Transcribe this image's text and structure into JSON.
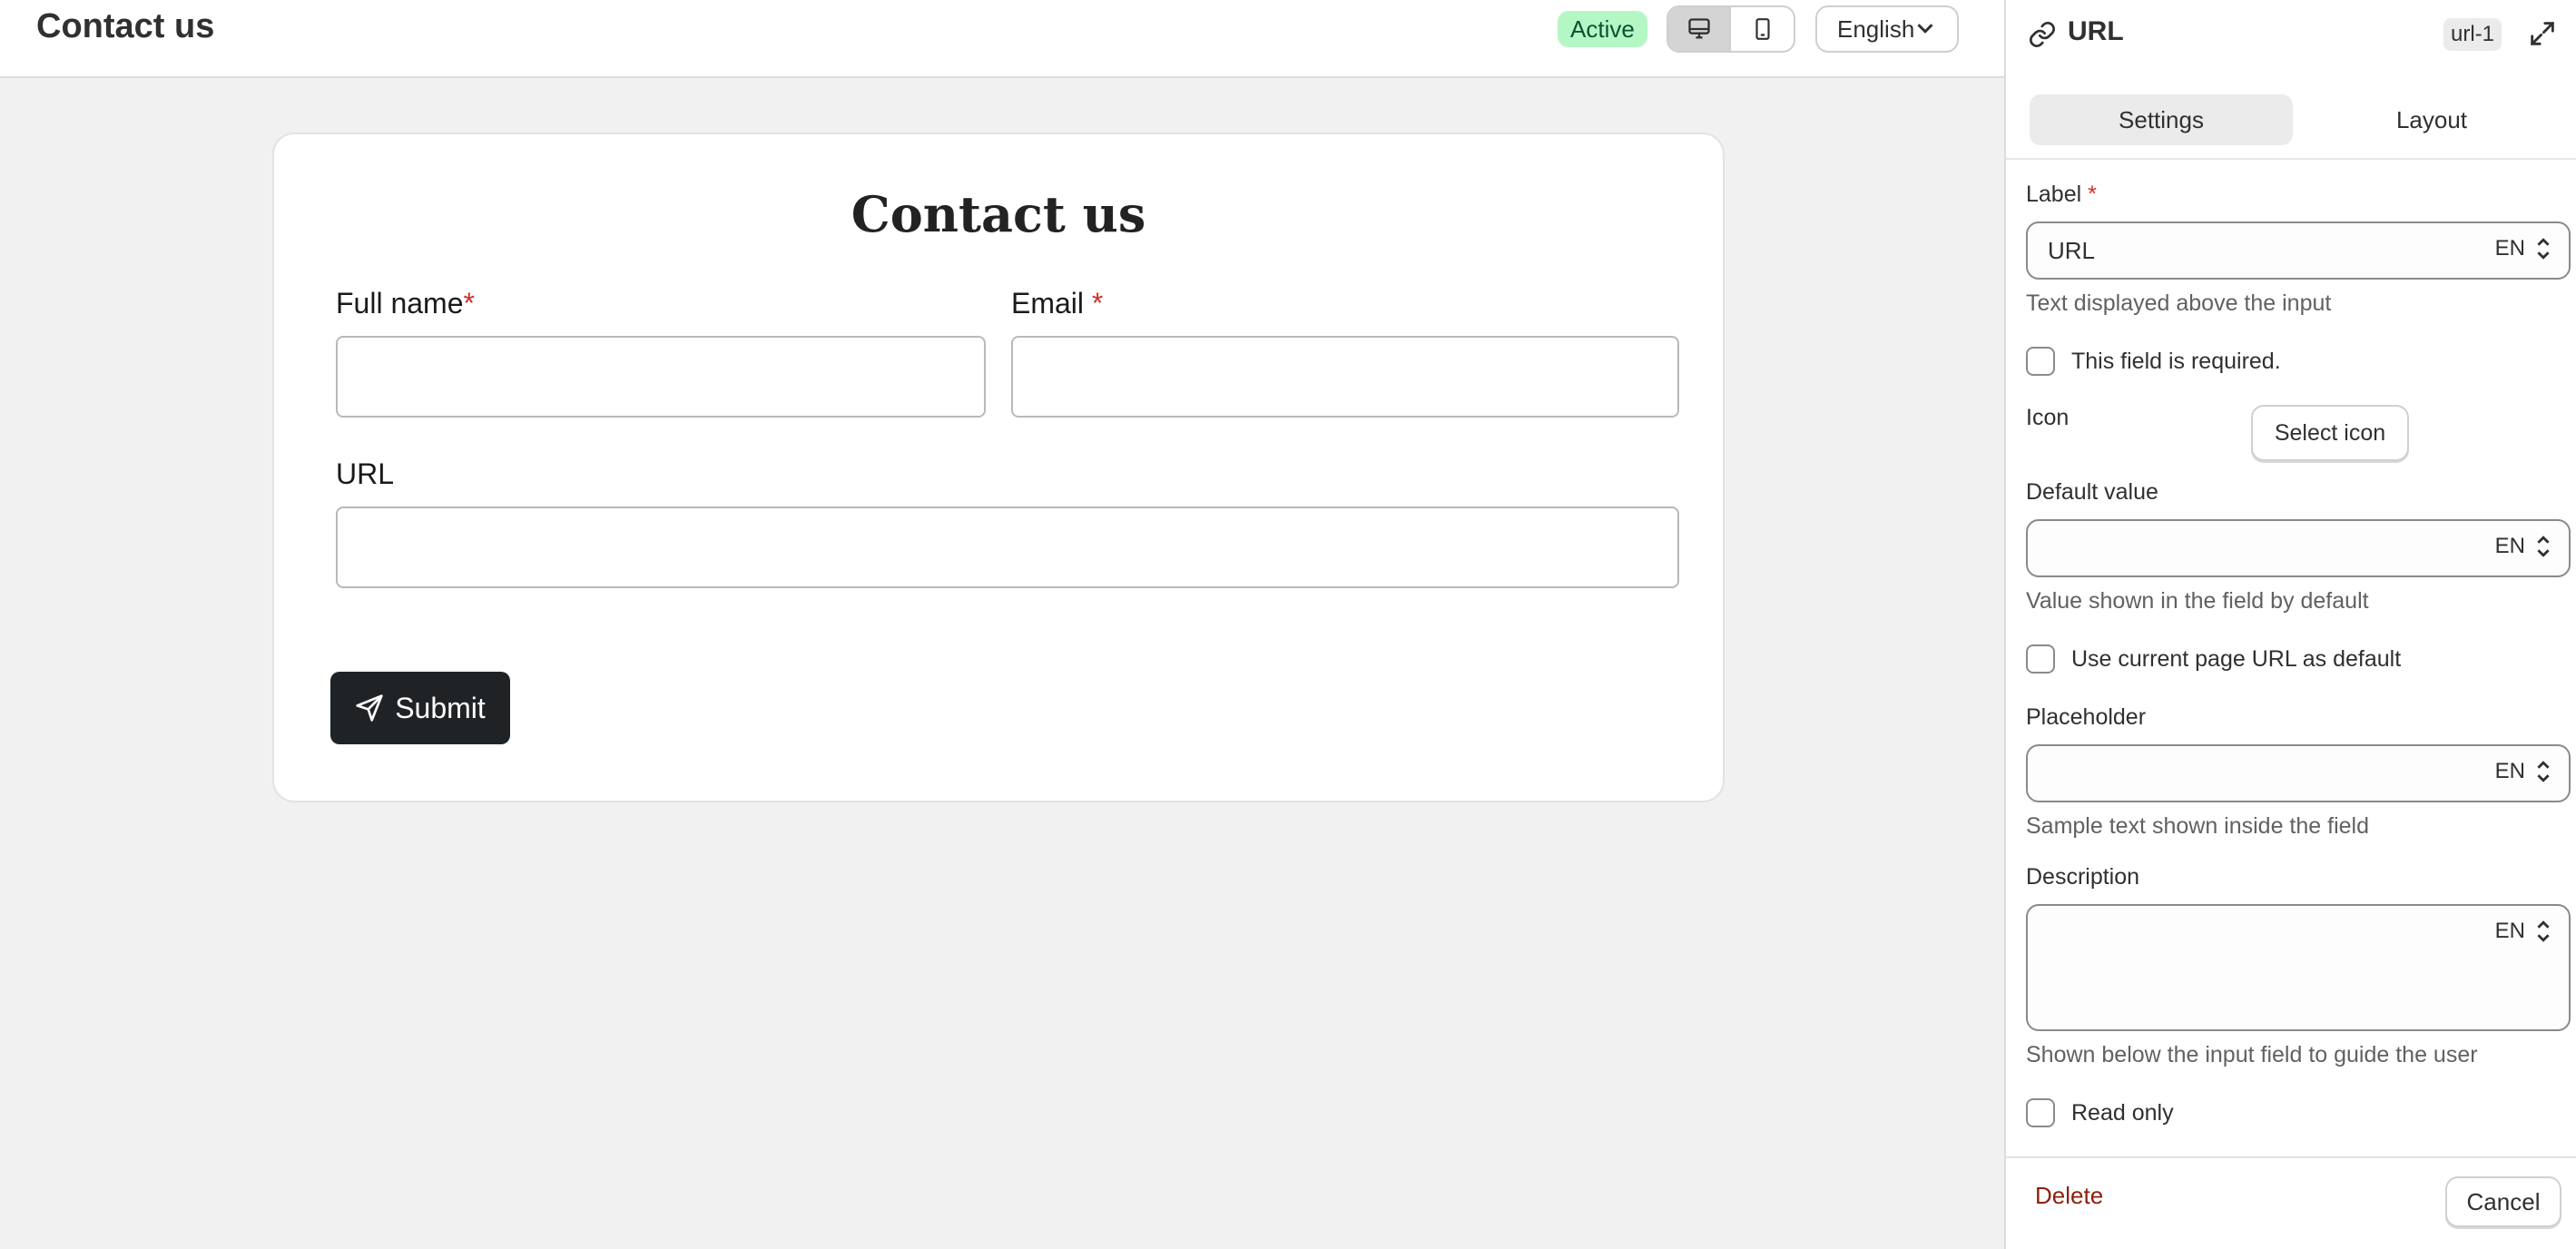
{
  "header": {
    "title": "Contact us",
    "status": "Active",
    "language": "English",
    "device_options": [
      "desktop-icon",
      "mobile-icon"
    ]
  },
  "form": {
    "heading": "Contact us",
    "fields": [
      {
        "label": "Full name",
        "required_mark": "*"
      },
      {
        "label": "Email",
        "required_mark": "*"
      },
      {
        "label": "URL",
        "required_mark": ""
      }
    ],
    "submit_label": "Submit"
  },
  "panel": {
    "title": "URL",
    "id": "url-1",
    "tabs": [
      {
        "label": "Settings",
        "active": true
      },
      {
        "label": "Layout",
        "active": false
      }
    ],
    "label_field": {
      "label": "Label",
      "required_mark": "*",
      "value": "URL",
      "lang": "EN",
      "help": "Text displayed above the input"
    },
    "required_checkbox": {
      "label": "This field is required.",
      "checked": false
    },
    "icon": {
      "label": "Icon",
      "button": "Select icon"
    },
    "default_value": {
      "label": "Default value",
      "value": "",
      "lang": "EN",
      "help": "Value shown in the field by default"
    },
    "current_url_checkbox": {
      "label": "Use current page URL as default",
      "checked": false
    },
    "placeholder": {
      "label": "Placeholder",
      "value": "",
      "lang": "EN",
      "help": "Sample text shown inside the field"
    },
    "description": {
      "label": "Description",
      "value": "",
      "lang": "EN",
      "help": "Shown below the input field to guide the user"
    },
    "read_only_checkbox": {
      "label": "Read only",
      "checked": false
    },
    "footer": {
      "delete": "Delete",
      "cancel": "Cancel"
    }
  },
  "colors": {
    "badge_bg": "#b4f7c5",
    "submit_bg": "#1f2326",
    "required": "#d62c2c",
    "delete": "#8e1f0b"
  }
}
